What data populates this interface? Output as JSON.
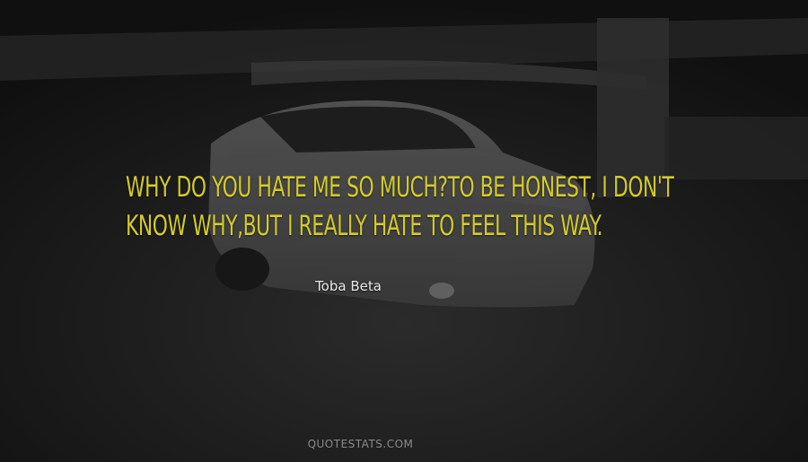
{
  "quote": {
    "text": "WHY DO YOU HATE ME SO MUCH?TO BE HONEST, I DON'T KNOW WHY,BUT I REALLY HATE TO FEEL THIS WAY.",
    "color": "#d4cb2a"
  },
  "author": {
    "name": "Toba Beta"
  },
  "watermark": {
    "site": "QUOTESTATS.COM"
  },
  "background": {
    "description_icon": "car-photo-background"
  }
}
